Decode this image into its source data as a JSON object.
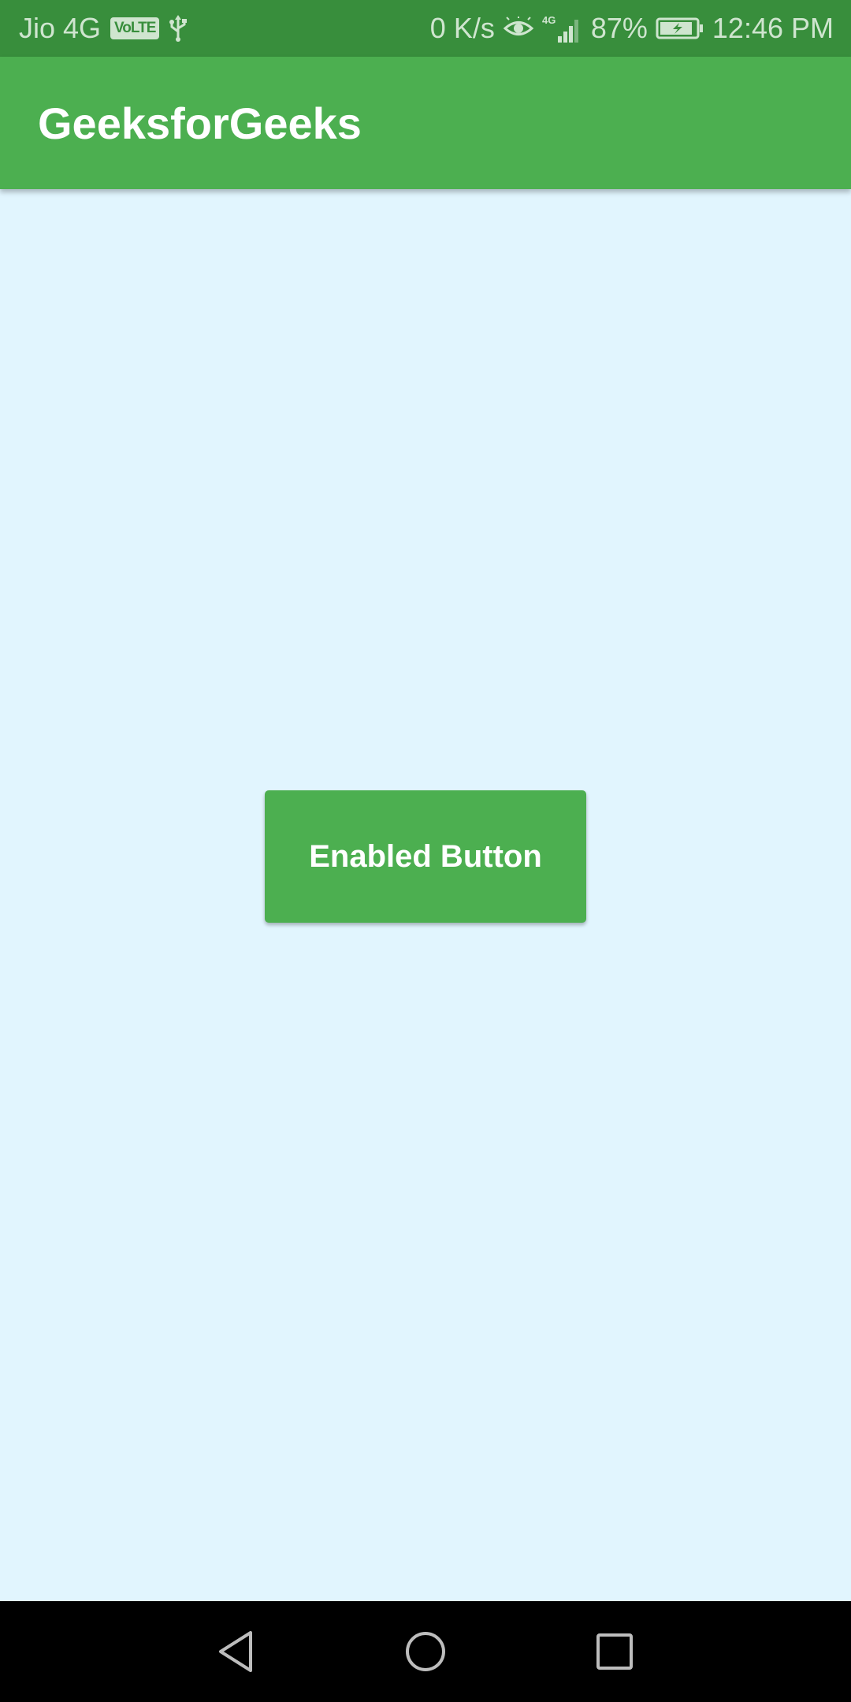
{
  "status_bar": {
    "carrier": "Jio 4G",
    "volte": "VoLTE",
    "net_speed": "0 K/s",
    "network": "4G",
    "battery": "87%",
    "time": "12:46 PM",
    "icons": [
      "usb-icon",
      "eye-icon",
      "signal-icon",
      "battery-charging-icon"
    ]
  },
  "app_bar": {
    "title": "GeeksforGeeks"
  },
  "main": {
    "button_label": "Enabled Button"
  },
  "nav_bar": {
    "icons": [
      "back-icon",
      "home-icon",
      "recents-icon"
    ]
  },
  "colors": {
    "status_bar": "#388e3c",
    "app_bar": "#4caf50",
    "background": "#e1f5fe",
    "button": "#4caf50",
    "nav_bar": "#000000"
  }
}
